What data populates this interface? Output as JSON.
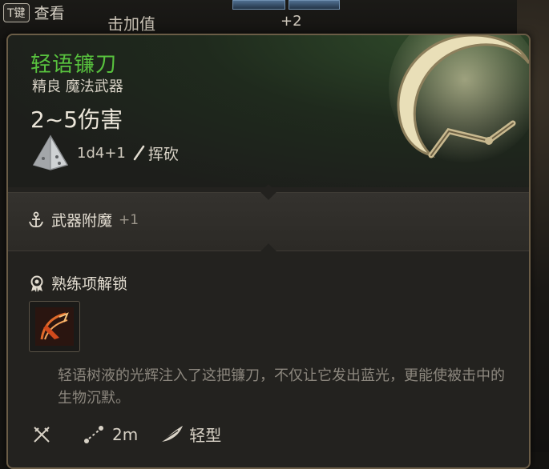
{
  "background": {
    "key_badge": "T键",
    "key_label": "查看",
    "attack_bonus_label": "击加值",
    "plus_value": "+2"
  },
  "tooltip": {
    "name": "轻语镰刀",
    "name_color": "#58c23e",
    "subtitle": "精良 魔法武器",
    "damage": "2~5伤害",
    "dice": "1d4+1",
    "attack_type": "挥砍",
    "enchantment": {
      "label": "武器附魔",
      "value": "+1"
    },
    "proficiency": {
      "label": "熟练项解锁"
    },
    "description": "轻语树液的光辉注入了这把镰刀，不仅让它发出蓝光，更能使被击中的生物沉默。",
    "footer": {
      "range": "2m",
      "weight_class": "轻型"
    }
  },
  "icons": [
    "dice-icon",
    "slash-icon",
    "anchor-icon",
    "medal-icon",
    "skill-icon",
    "swords-icon",
    "range-icon",
    "feather-icon",
    "sickle-weapon-icon"
  ]
}
